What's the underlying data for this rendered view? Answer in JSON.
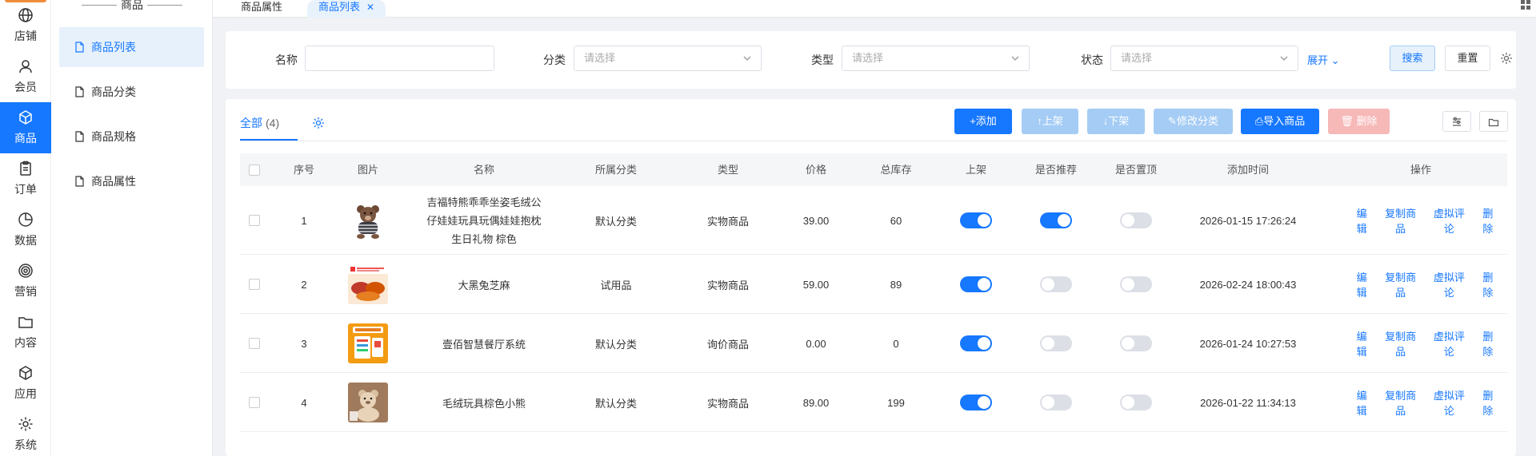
{
  "rail": {
    "items": [
      {
        "label": "店铺",
        "icon": "globe-icon"
      },
      {
        "label": "会员",
        "icon": "user-icon"
      },
      {
        "label": "商品",
        "icon": "box-icon",
        "active": true
      },
      {
        "label": "订单",
        "icon": "clipboard-icon"
      },
      {
        "label": "数据",
        "icon": "pie-icon"
      },
      {
        "label": "营销",
        "icon": "target-icon"
      },
      {
        "label": "内容",
        "icon": "folder-icon"
      },
      {
        "label": "应用",
        "icon": "cube-icon"
      },
      {
        "label": "系统",
        "icon": "gear-icon"
      }
    ]
  },
  "submenu": {
    "title": "商品",
    "items": [
      {
        "label": "商品列表",
        "active": true
      },
      {
        "label": "商品分类"
      },
      {
        "label": "商品规格"
      },
      {
        "label": "商品属性"
      }
    ]
  },
  "tabs": [
    {
      "label": "商品属性"
    },
    {
      "label": "商品列表",
      "active": true
    }
  ],
  "filter": {
    "name_label": "名称",
    "name_value": "",
    "category_label": "分类",
    "category_placeholder": "请选择",
    "type_label": "类型",
    "type_placeholder": "请选择",
    "status_label": "状态",
    "status_placeholder": "请选择",
    "expand_label": "展开",
    "search_label": "搜索",
    "reset_label": "重置"
  },
  "list_tab": {
    "label": "全部",
    "count": "(4)"
  },
  "toolbar": {
    "add": "+添加",
    "on_shelf": "↑上架",
    "off_shelf": "↓下架",
    "edit_category": "修改分类",
    "import": "导入商品",
    "delete": "删除"
  },
  "table": {
    "headers": [
      "序号",
      "图片",
      "名称",
      "所属分类",
      "类型",
      "价格",
      "总库存",
      "上架",
      "是否推荐",
      "是否置顶",
      "添加时间",
      "操作"
    ],
    "rows": [
      {
        "no": "1",
        "name": "吉福特熊乖乖坐姿毛绒公仔娃娃玩具玩偶娃娃抱枕生日礼物 棕色",
        "category": "默认分类",
        "type": "实物商品",
        "price": "39.00",
        "stock": "60",
        "on_shelf": true,
        "recommend": true,
        "top": false,
        "time": "2026-01-15 17:26:24",
        "image": "bear"
      },
      {
        "no": "2",
        "name": "大黑兔芝麻",
        "category": "试用品",
        "type": "实物商品",
        "price": "59.00",
        "stock": "89",
        "on_shelf": true,
        "recommend": false,
        "top": false,
        "time": "2026-02-24 18:00:43",
        "image": "food"
      },
      {
        "no": "3",
        "name": "壹佰智慧餐厅系统",
        "category": "默认分类",
        "type": "询价商品",
        "price": "0.00",
        "stock": "0",
        "on_shelf": true,
        "recommend": false,
        "top": false,
        "time": "2026-01-24 10:27:53",
        "image": "poster"
      },
      {
        "no": "4",
        "name": "毛绒玩具棕色小熊",
        "category": "默认分类",
        "type": "实物商品",
        "price": "89.00",
        "stock": "199",
        "on_shelf": true,
        "recommend": false,
        "top": false,
        "time": "2026-01-22 11:34:13",
        "image": "bear2"
      }
    ],
    "ops": [
      "编辑",
      "复制商品",
      "虚拟评论",
      "删除"
    ]
  },
  "colors": {
    "primary": "#1677ff",
    "primary_light": "#a5ccf5",
    "danger_light": "#f7b8b8",
    "accent": "#f08d3b"
  }
}
